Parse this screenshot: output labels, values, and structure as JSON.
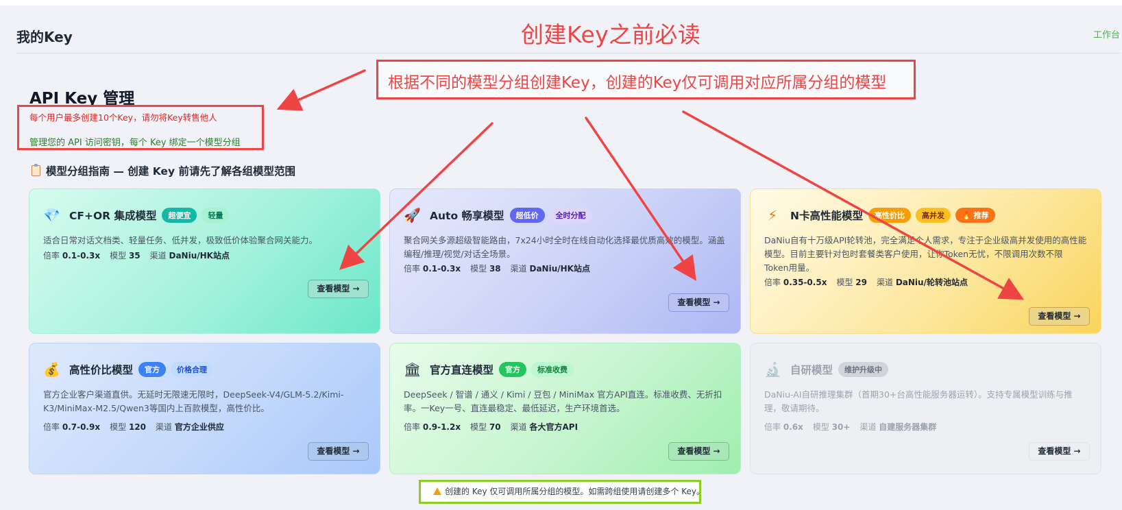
{
  "header": {
    "title": "我的Key",
    "workbench_link": "工作台"
  },
  "annotations": {
    "headline": "创建Key之前必读",
    "top_box": "根据不同的模型分组创建Key，创建的Key仅可调用对应所属分组的模型",
    "color": "#ef4444",
    "note_border_color": "#8ccf23"
  },
  "api_section": {
    "title": "API Key 管理",
    "limit_notice": "每个用户最多创建10个Key，请勿将Key转售他人",
    "subtitle": "管理您的 API 访问密钥，每个 Key 绑定一个模型分组"
  },
  "guide": {
    "icon": "clipboard-icon",
    "title": "模型分组指南 — 创建 Key 前请先了解各组模型范围"
  },
  "meta_labels": {
    "rate": "倍率",
    "models": "模型",
    "channel": "渠道"
  },
  "cards": [
    {
      "icon": "gem-icon",
      "icon_glyph": "💎",
      "name": "CF+OR 集成模型",
      "badges": [
        "超便宜",
        "轻量"
      ],
      "desc": "适合日常对话文档类、轻量任务、低并发，极致低价体验聚合网关能力。",
      "rate": "0.1-0.3x",
      "models": "35",
      "channel": "DaNiu/HK站点",
      "button": "查看模型 →"
    },
    {
      "icon": "rocket-icon",
      "icon_glyph": "🚀",
      "name": "Auto 畅享模型",
      "badges": [
        "超低价",
        "全时分配"
      ],
      "desc": "聚合网关多源超级智能路由，7x24小时全时在线自动化选择最优质高效的模型。涵盖编程/推理/视觉/对话全场景。",
      "rate": "0.1-0.3x",
      "models": "38",
      "channel": "DaNiu/HK站点",
      "button": "查看模型 →"
    },
    {
      "icon": "lightning-icon",
      "icon_glyph": "⚡",
      "name": "N卡高性能模型",
      "badges": [
        "高性价比",
        "高并发",
        "🔥 推荐"
      ],
      "desc": "DaNiu自有十万级API轮转池，完全满足个人需求，专注于企业级高并发使用的高性能模型。目前主要针对包时套餐类客户使用，让你Token无忧，不限调用次数不限Token用量。",
      "rate": "0.35-0.5x",
      "models": "29",
      "channel": "DaNiu/轮转池站点",
      "button": "查看模型 →"
    },
    {
      "icon": "money-bag-icon",
      "icon_glyph": "💰",
      "name": "高性价比模型",
      "badges": [
        "官方",
        "价格合理"
      ],
      "desc": "官方企业客户渠道直供。无延时无限速无限时，DeepSeek-V4/GLM-5.2/Kimi-K3/MiniMax-M2.5/Qwen3等国内上百款模型，高性价比。",
      "rate": "0.7-0.9x",
      "models": "120",
      "channel": "官方企业供应",
      "button": "查看模型 →"
    },
    {
      "icon": "bank-icon",
      "icon_glyph": "🏛",
      "name": "官方直连模型",
      "badges": [
        "官方",
        "标准收费"
      ],
      "desc": "DeepSeek / 智谱 / 通义 / Kimi / 豆包 / MiniMax 官方API直连。标准收费、无折扣率。一Key一号、直连最稳定、最低延迟，生产环境首选。",
      "rate": "0.9-1.2x",
      "models": "70",
      "channel": "各大官方API",
      "button": "查看模型 →"
    },
    {
      "icon": "microscope-icon",
      "icon_glyph": "🔬",
      "name": "自研模型",
      "badges": [
        "维护升级中"
      ],
      "desc": "DaNiu-AI自研推理集群（首期30+台高性能服务器运转）。支持专属模型训练与推理，敬请期待。",
      "rate": "0.6x",
      "models": "30+",
      "channel": "自建服务器集群",
      "button": "查看模型 →"
    }
  ],
  "bottom_note": "创建的 Key 仅可调用所属分组的模型。如需跨组使用请创建多个 Key。"
}
